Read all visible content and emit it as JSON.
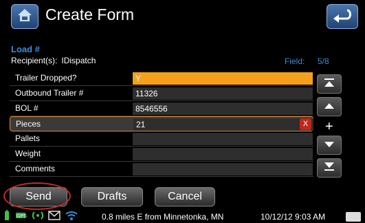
{
  "header": {
    "title": "Create Form",
    "home_icon": "home-icon",
    "back_icon": "back-arrow-icon"
  },
  "info": {
    "load_label": "Load #",
    "recipients_label": "Recipient(s):",
    "recipients_value": "IDispatch",
    "field_label": "Field:",
    "field_value": "5/8"
  },
  "rows": [
    {
      "label": "Trailer Dropped?",
      "value": "Y"
    },
    {
      "label": "Outbound Trailer #",
      "value": "11326"
    },
    {
      "label": "BOL #",
      "value": "8546556"
    },
    {
      "label": "Pieces",
      "value": "21",
      "clear": "X"
    },
    {
      "label": "Pallets",
      "value": ""
    },
    {
      "label": "Weight",
      "value": ""
    },
    {
      "label": "Comments",
      "value": ""
    }
  ],
  "scroll": {
    "plus": "+"
  },
  "buttons": {
    "send": "Send",
    "drafts": "Drafts",
    "cancel": "Cancel"
  },
  "status": {
    "location": "0.8 miles E from Minnetonka, MN",
    "datetime": "10/12/12 9:03 AM",
    "gps_text": "GPS"
  },
  "colors": {
    "accent_blue": "#3f8bd8",
    "active_field": "#f4a01b",
    "highlight_ring": "#c52a2a"
  }
}
